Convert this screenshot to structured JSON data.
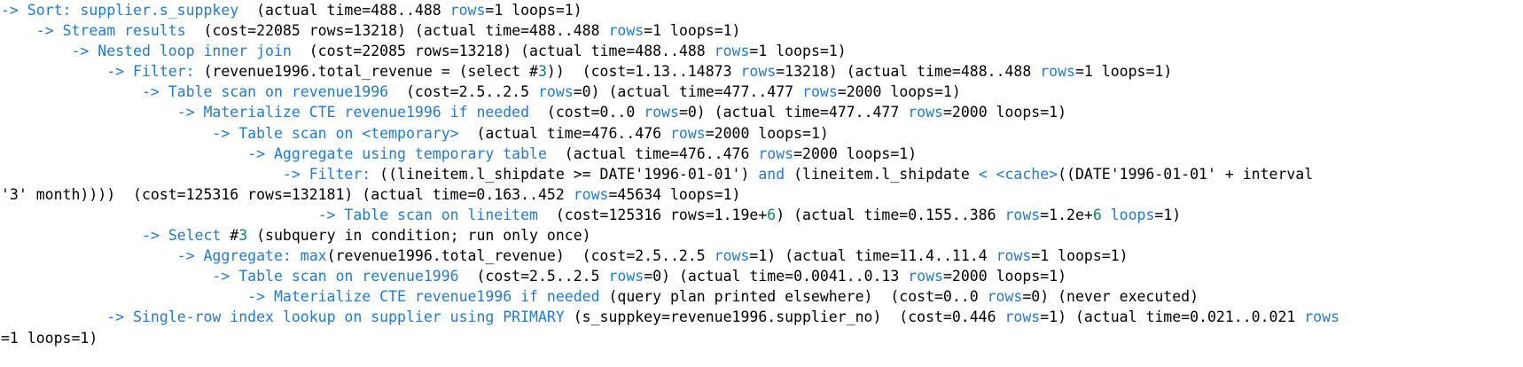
{
  "colors": {
    "keyword": "#1f7ad6",
    "number": "#098658",
    "text": "#000000",
    "background": "#ffffff"
  },
  "lines": [
    [
      [
        "k",
        "-> Sort: supplier.s_suppkey"
      ],
      [
        "t",
        "  (actual time=488..488 "
      ],
      [
        "k",
        "rows"
      ],
      [
        "t",
        "=1 loops=1)"
      ]
    ],
    [
      [
        "t",
        "    "
      ],
      [
        "k",
        "-> Stream results"
      ],
      [
        "t",
        "  (cost=22085 rows=13218) (actual time=488..488 "
      ],
      [
        "k",
        "rows"
      ],
      [
        "t",
        "=1 loops=1)"
      ]
    ],
    [
      [
        "t",
        "        "
      ],
      [
        "k",
        "-> Nested loop inner join"
      ],
      [
        "t",
        "  (cost=22085 rows=13218) (actual time=488..488 "
      ],
      [
        "k",
        "rows"
      ],
      [
        "t",
        "=1 loops=1)"
      ]
    ],
    [
      [
        "t",
        "            "
      ],
      [
        "k",
        "-> Filter:"
      ],
      [
        "t",
        " (revenue1996.total_revenue = (select #"
      ],
      [
        "n",
        "3"
      ],
      [
        "t",
        "))  (cost=1.13..14873 "
      ],
      [
        "k",
        "rows"
      ],
      [
        "t",
        "=13218) (actual time=488..488 "
      ],
      [
        "k",
        "rows"
      ],
      [
        "t",
        "=1 loops=1)"
      ]
    ],
    [
      [
        "t",
        "                "
      ],
      [
        "k",
        "-> Table scan on revenue1996"
      ],
      [
        "t",
        "  (cost=2.5..2.5 "
      ],
      [
        "k",
        "rows"
      ],
      [
        "t",
        "=0) (actual time=477..477 "
      ],
      [
        "k",
        "rows"
      ],
      [
        "t",
        "=2000 loops=1)"
      ]
    ],
    [
      [
        "t",
        "                    "
      ],
      [
        "k",
        "-> Materialize CTE revenue1996 if needed"
      ],
      [
        "t",
        "  (cost=0..0 "
      ],
      [
        "k",
        "rows"
      ],
      [
        "t",
        "=0) (actual time=477..477 "
      ],
      [
        "k",
        "rows"
      ],
      [
        "t",
        "=2000 loops=1)"
      ]
    ],
    [
      [
        "t",
        "                        "
      ],
      [
        "k",
        "-> Table scan on <temporary>"
      ],
      [
        "t",
        "  (actual time=476..476 "
      ],
      [
        "k",
        "rows"
      ],
      [
        "t",
        "=2000 loops=1)"
      ]
    ],
    [
      [
        "t",
        "                            "
      ],
      [
        "k",
        "-> Aggregate using temporary table"
      ],
      [
        "t",
        "  (actual time=476..476 "
      ],
      [
        "k",
        "rows"
      ],
      [
        "t",
        "=2000 loops=1)"
      ]
    ],
    [
      [
        "t",
        "                                "
      ],
      [
        "k",
        "-> Filter:"
      ],
      [
        "t",
        " ((lineitem.l_shipdate >= DATE'1996-01-01') "
      ],
      [
        "k",
        "and"
      ],
      [
        "t",
        " (lineitem.l_shipdate "
      ],
      [
        "k",
        "< <cache>"
      ],
      [
        "t",
        "((DATE'1996-01-01' + interval"
      ]
    ],
    [
      [
        "t",
        "'3' month))))  (cost=125316 rows=132181) (actual time=0.163..452 "
      ],
      [
        "k",
        "rows"
      ],
      [
        "t",
        "=45634 loops=1)"
      ]
    ],
    [
      [
        "t",
        "                                    "
      ],
      [
        "k",
        "-> Table scan on lineitem"
      ],
      [
        "t",
        "  (cost=125316 rows=1.19e+"
      ],
      [
        "n",
        "6"
      ],
      [
        "t",
        ") (actual time=0.155..386 "
      ],
      [
        "k",
        "rows"
      ],
      [
        "t",
        "=1.2e+"
      ],
      [
        "n",
        "6"
      ],
      [
        "t",
        " "
      ],
      [
        "k",
        "loops"
      ],
      [
        "t",
        "=1)"
      ]
    ],
    [
      [
        "t",
        "                "
      ],
      [
        "k",
        "-> Select"
      ],
      [
        "t",
        " #"
      ],
      [
        "n",
        "3"
      ],
      [
        "t",
        " (subquery in condition; run only once)"
      ]
    ],
    [
      [
        "t",
        "                    "
      ],
      [
        "k",
        "-> Aggregate:"
      ],
      [
        "t",
        " "
      ],
      [
        "k",
        "max"
      ],
      [
        "t",
        "(revenue1996.total_revenue)  (cost=2.5..2.5 "
      ],
      [
        "k",
        "rows"
      ],
      [
        "t",
        "=1) (actual time=11.4..11.4 "
      ],
      [
        "k",
        "rows"
      ],
      [
        "t",
        "=1 loops=1)"
      ]
    ],
    [
      [
        "t",
        "                        "
      ],
      [
        "k",
        "-> Table scan on revenue1996"
      ],
      [
        "t",
        "  (cost=2.5..2.5 "
      ],
      [
        "k",
        "rows"
      ],
      [
        "t",
        "=0) (actual time=0.0041..0.13 "
      ],
      [
        "k",
        "rows"
      ],
      [
        "t",
        "=2000 loops=1)"
      ]
    ],
    [
      [
        "t",
        "                            "
      ],
      [
        "k",
        "-> Materialize CTE revenue1996 if needed"
      ],
      [
        "t",
        " (query plan printed elsewhere)  (cost=0..0 "
      ],
      [
        "k",
        "rows"
      ],
      [
        "t",
        "=0) (never executed)"
      ]
    ],
    [
      [
        "t",
        "            "
      ],
      [
        "k",
        "-> Single-row index lookup on supplier using PRIMARY"
      ],
      [
        "t",
        " (s_suppkey=revenue1996.supplier_no)  (cost=0.446 "
      ],
      [
        "k",
        "rows"
      ],
      [
        "t",
        "=1) (actual time=0.021..0.021 "
      ],
      [
        "k",
        "rows"
      ]
    ],
    [
      [
        "t",
        "=1 loops=1)"
      ]
    ]
  ]
}
